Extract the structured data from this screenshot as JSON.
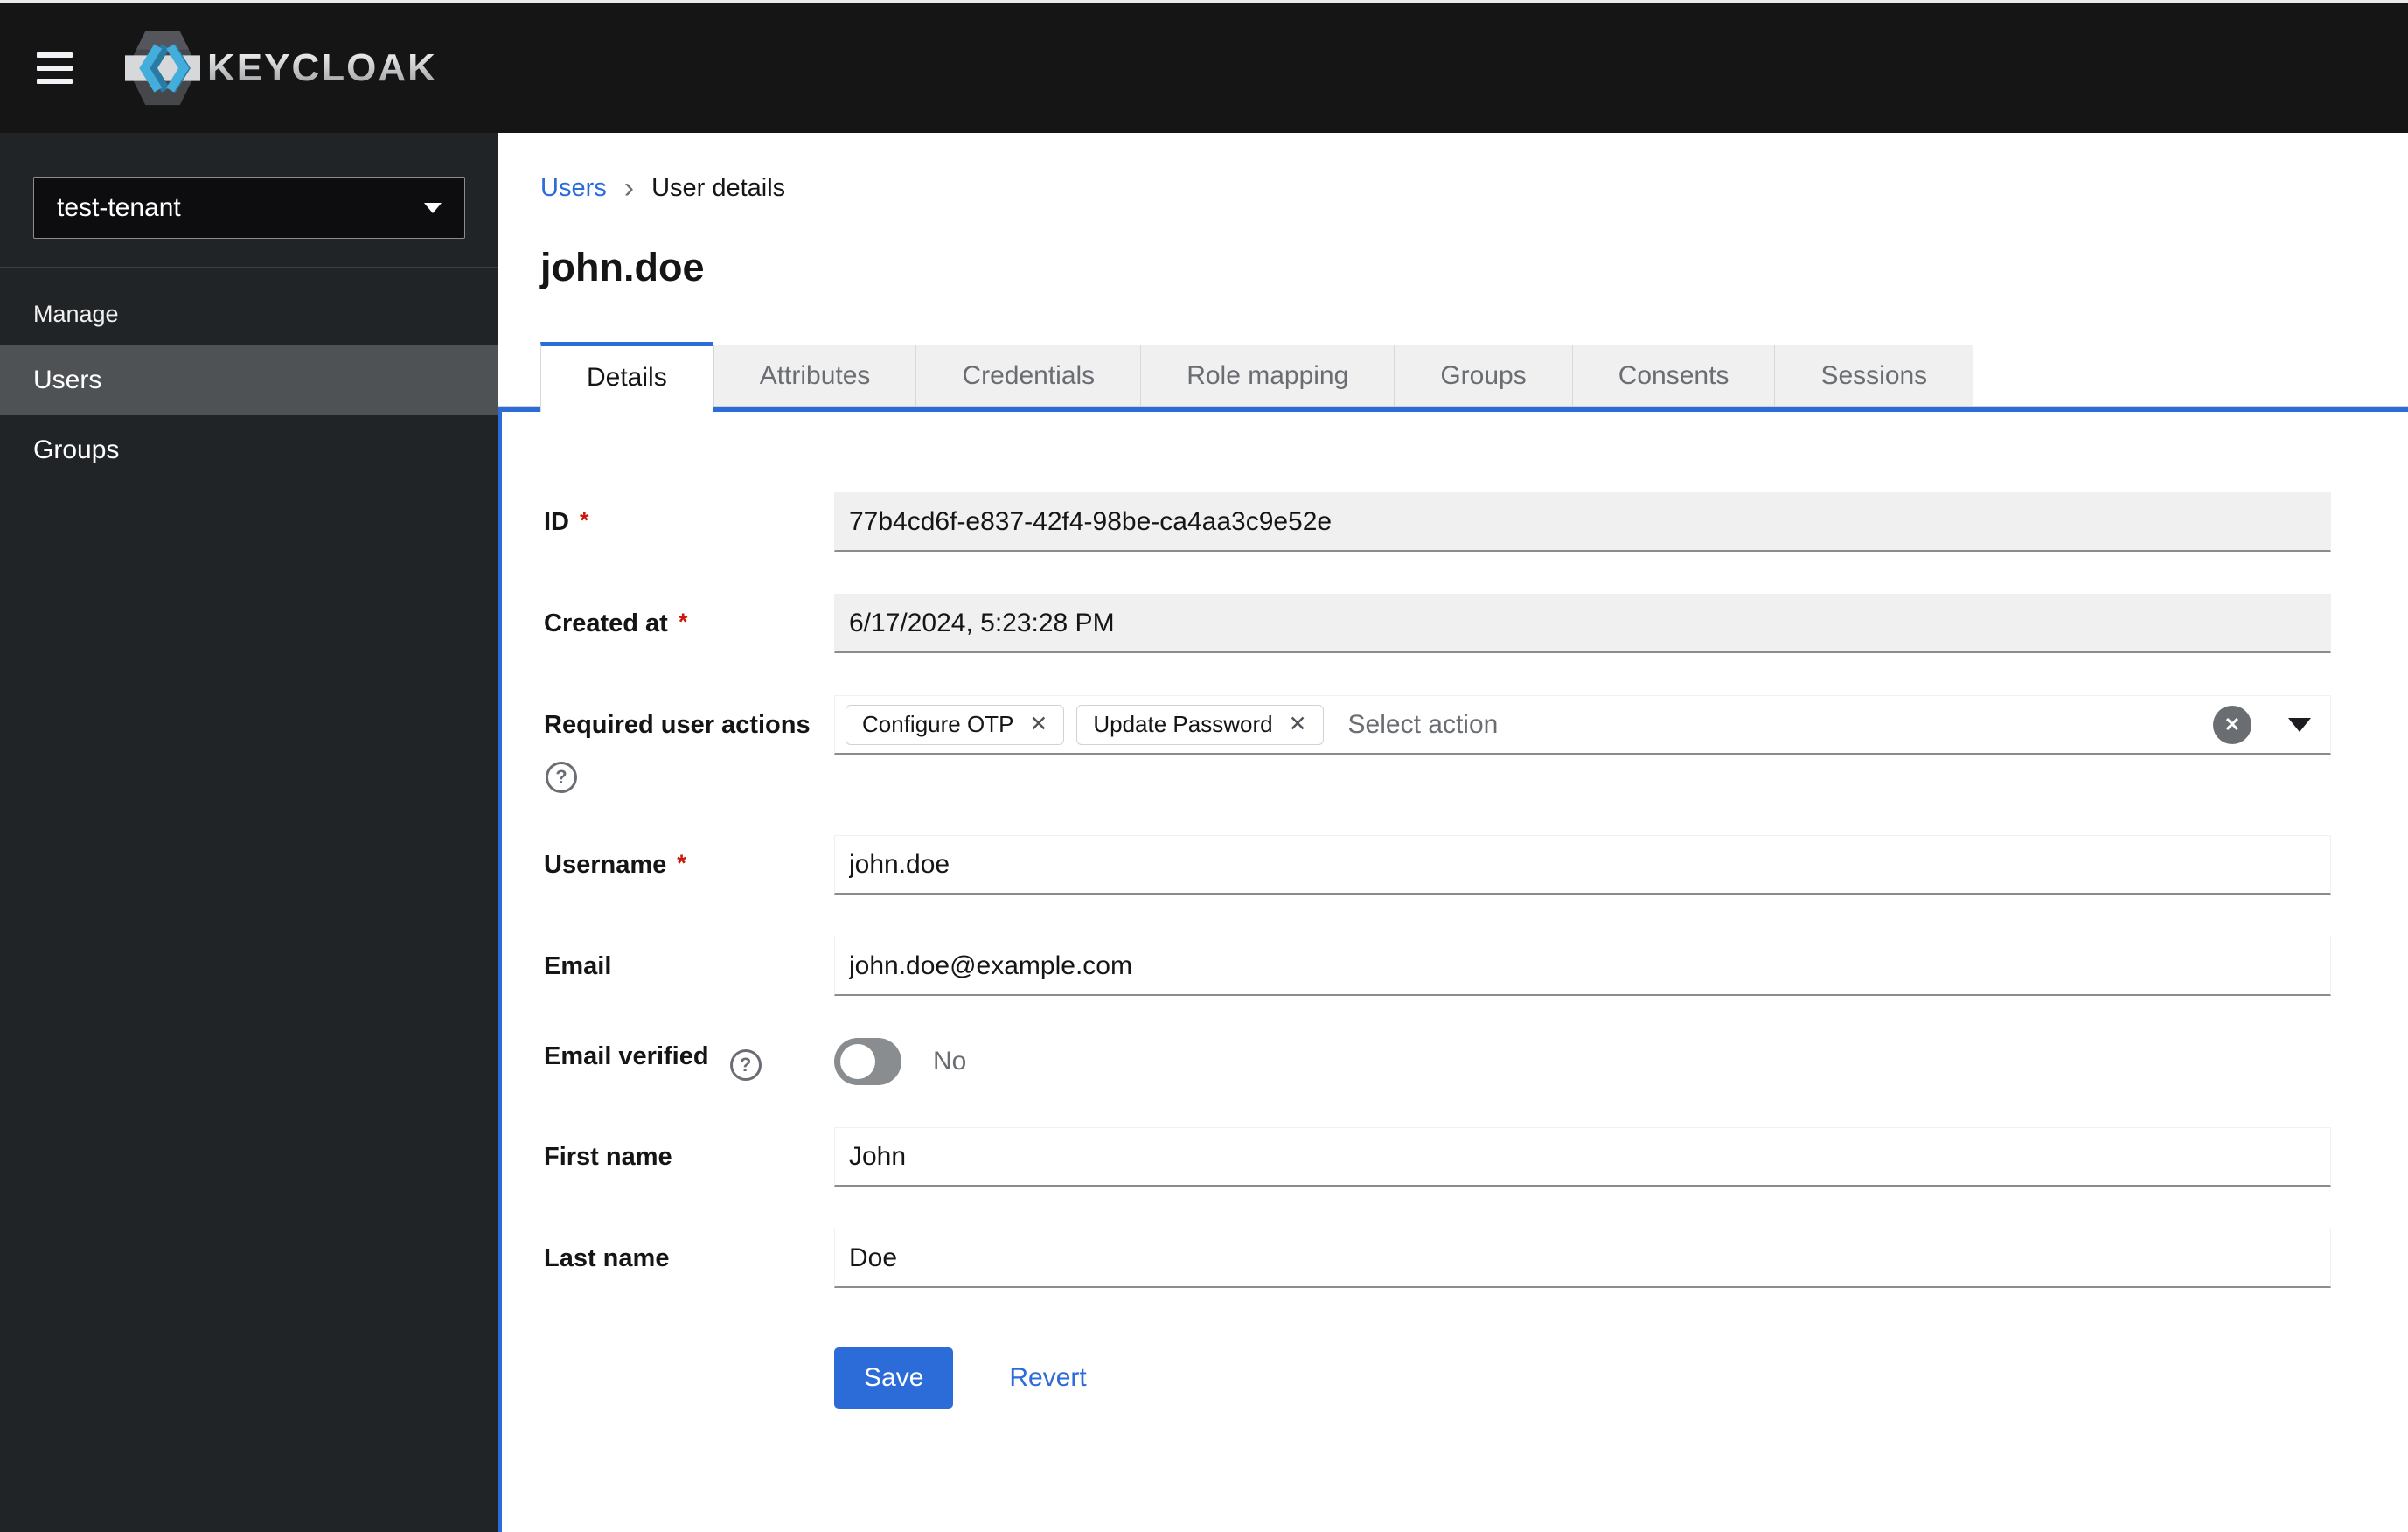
{
  "header": {
    "brand_text": "KEYCLOAK"
  },
  "sidebar": {
    "realm_selector": {
      "value": "test-tenant"
    },
    "section_label": "Manage",
    "nav_items": [
      {
        "label": "Users",
        "selected": true
      },
      {
        "label": "Groups",
        "selected": false
      }
    ]
  },
  "breadcrumb": {
    "parent": "Users",
    "separator": "›",
    "current": "User details"
  },
  "page_title": "john.doe",
  "tabs": {
    "active": "Details",
    "items": [
      "Details",
      "Attributes",
      "Credentials",
      "Role mapping",
      "Groups",
      "Consents",
      "Sessions"
    ]
  },
  "form": {
    "id": {
      "label": "ID",
      "required": "*",
      "value": "77b4cd6f-e837-42f4-98be-ca4aa3c9e52e"
    },
    "created_at": {
      "label": "Created at",
      "required": "*",
      "value": "6/17/2024, 5:23:28 PM"
    },
    "required_user_actions": {
      "label": "Required user actions",
      "chips": [
        "Configure OTP",
        "Update Password"
      ],
      "placeholder": "Select action"
    },
    "username": {
      "label": "Username",
      "required": "*",
      "value": "john.doe"
    },
    "email": {
      "label": "Email",
      "value": "john.doe@example.com"
    },
    "email_verified": {
      "label": "Email verified",
      "state_label": "No",
      "on": false
    },
    "first_name": {
      "label": "First name",
      "value": "John"
    },
    "last_name": {
      "label": "Last name",
      "value": "Doe"
    },
    "actions": {
      "save": "Save",
      "revert": "Revert"
    }
  },
  "icons": {
    "chip_remove": "✕",
    "clear": "✕",
    "help": "?"
  },
  "colors": {
    "accent": "#2b6cd9",
    "header-bg": "#151515",
    "sidebar-bg": "#212427",
    "nav-selected-bg": "#4f5255",
    "readonly-bg": "#f0f0f0",
    "border-strong": "#8a8d90",
    "muted": "#6a6e73",
    "danger": "#c9190b"
  }
}
